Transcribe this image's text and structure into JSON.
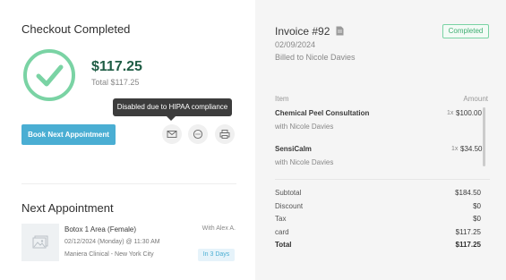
{
  "checkout": {
    "title": "Checkout Completed",
    "amount": "$117.25",
    "total_label": "Total $117.25"
  },
  "tooltip": {
    "text": "Disabled due to HIPAA compliance"
  },
  "actions": {
    "book_next_label": "Book Next Appointment",
    "email_icon": "envelope-icon",
    "sms_icon": "chat-bubble-icon",
    "print_icon": "printer-icon"
  },
  "next_appointment": {
    "title": "Next Appointment",
    "service": "Botox 1 Area (Female)",
    "with": "With Alex A.",
    "datetime": "02/12/2024 (Monday) @ 11:30 AM",
    "location": "Maniera Clinical - New York City",
    "badge": "In 3 Days",
    "thumb_icon": "image-placeholder-icon"
  },
  "invoice": {
    "title": "Invoice #92",
    "doc_icon": "document-icon",
    "status": "Completed",
    "date": "02/09/2024",
    "billed_to": "Billed to Nicole Davies",
    "columns": {
      "item": "Item",
      "amount": "Amount"
    },
    "items": [
      {
        "name": "Chemical Peel Consultation",
        "provider": "with Nicole Davies",
        "qty": "1x",
        "price": "$100.00"
      },
      {
        "name": "SensiCalm",
        "provider": "with Nicole Davies",
        "qty": "1x",
        "price": "$34.50"
      }
    ],
    "summary": {
      "subtotal_label": "Subtotal",
      "subtotal": "$184.50",
      "discount_label": "Discount",
      "discount": "$0",
      "tax_label": "Tax",
      "tax": "$0",
      "card_label": "card",
      "card": "$117.25",
      "total_label": "Total",
      "total": "$117.25"
    }
  },
  "colors": {
    "success_green": "#7ad3a4",
    "amount_green": "#1f5d45",
    "primary_blue": "#4aaed3",
    "panel_gray": "#f5f5f5"
  }
}
